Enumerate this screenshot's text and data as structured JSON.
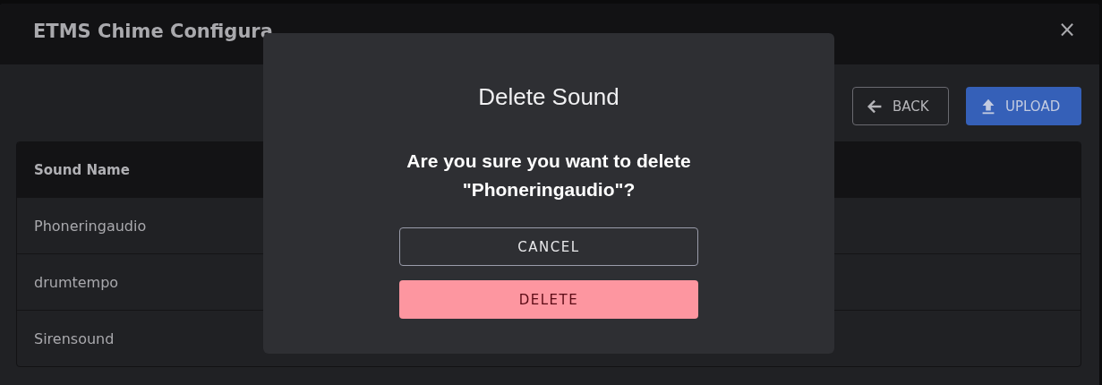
{
  "window": {
    "title": "ETMS Chime Configura",
    "close": "×"
  },
  "toolbar": [
    {
      "kind": "outline",
      "label": "BACK"
    },
    {
      "kind": "primary",
      "label": "UPLOAD"
    }
  ],
  "table": {
    "columns": [
      "Sound Name"
    ],
    "rows": [
      [
        "Phoneringaudio"
      ],
      [
        "drumtempo"
      ],
      [
        "Sirensound"
      ]
    ]
  },
  "dialog": {
    "title": "Delete Sound",
    "message": "Are you sure you want to delete \"Phoneringaudio\"?",
    "buttons": [
      {
        "kind": "outline",
        "label": "CANCEL"
      },
      {
        "kind": "danger",
        "label": "DELETE"
      }
    ]
  }
}
